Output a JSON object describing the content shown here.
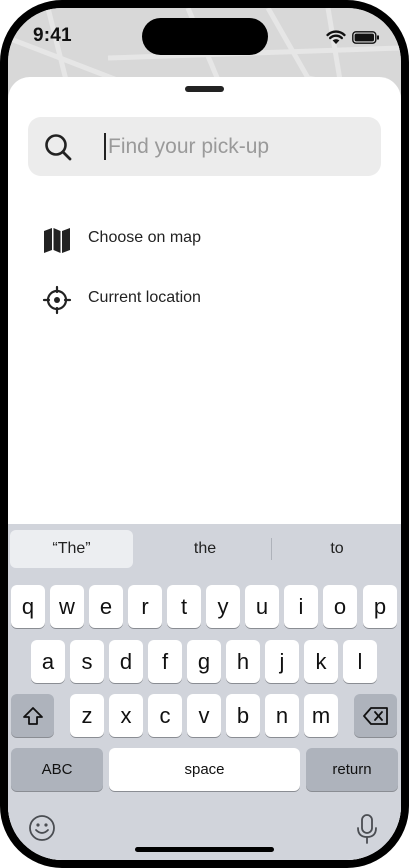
{
  "status_bar": {
    "time": "9:41",
    "wifi_icon": "wifi-icon",
    "battery_icon": "battery-icon"
  },
  "sheet": {
    "search": {
      "icon": "search-icon",
      "value": "",
      "placeholder": "Find your pick-up"
    },
    "options": [
      {
        "icon": "map-icon",
        "label": "Choose on map"
      },
      {
        "icon": "crosshair-icon",
        "label": "Current location"
      }
    ]
  },
  "keyboard": {
    "suggestions": [
      "“The”",
      "the",
      "to"
    ],
    "row1": [
      "q",
      "w",
      "e",
      "r",
      "t",
      "y",
      "u",
      "i",
      "o",
      "p"
    ],
    "row2": [
      "a",
      "s",
      "d",
      "f",
      "g",
      "h",
      "j",
      "k",
      "l"
    ],
    "row3": [
      "z",
      "x",
      "c",
      "v",
      "b",
      "n",
      "m"
    ],
    "shift_icon": "shift-icon",
    "delete_icon": "delete-icon",
    "abc_label": "ABC",
    "space_label": "space",
    "return_label": "return",
    "emoji_icon": "emoji-icon",
    "mic_icon": "microphone-icon"
  },
  "colors": {
    "keyboard_bg": "#d1d4db",
    "key_bg": "#ffffff",
    "special_key_bg": "#aeb3bc",
    "search_bg": "#ececec",
    "placeholder": "#9a9a9a"
  }
}
